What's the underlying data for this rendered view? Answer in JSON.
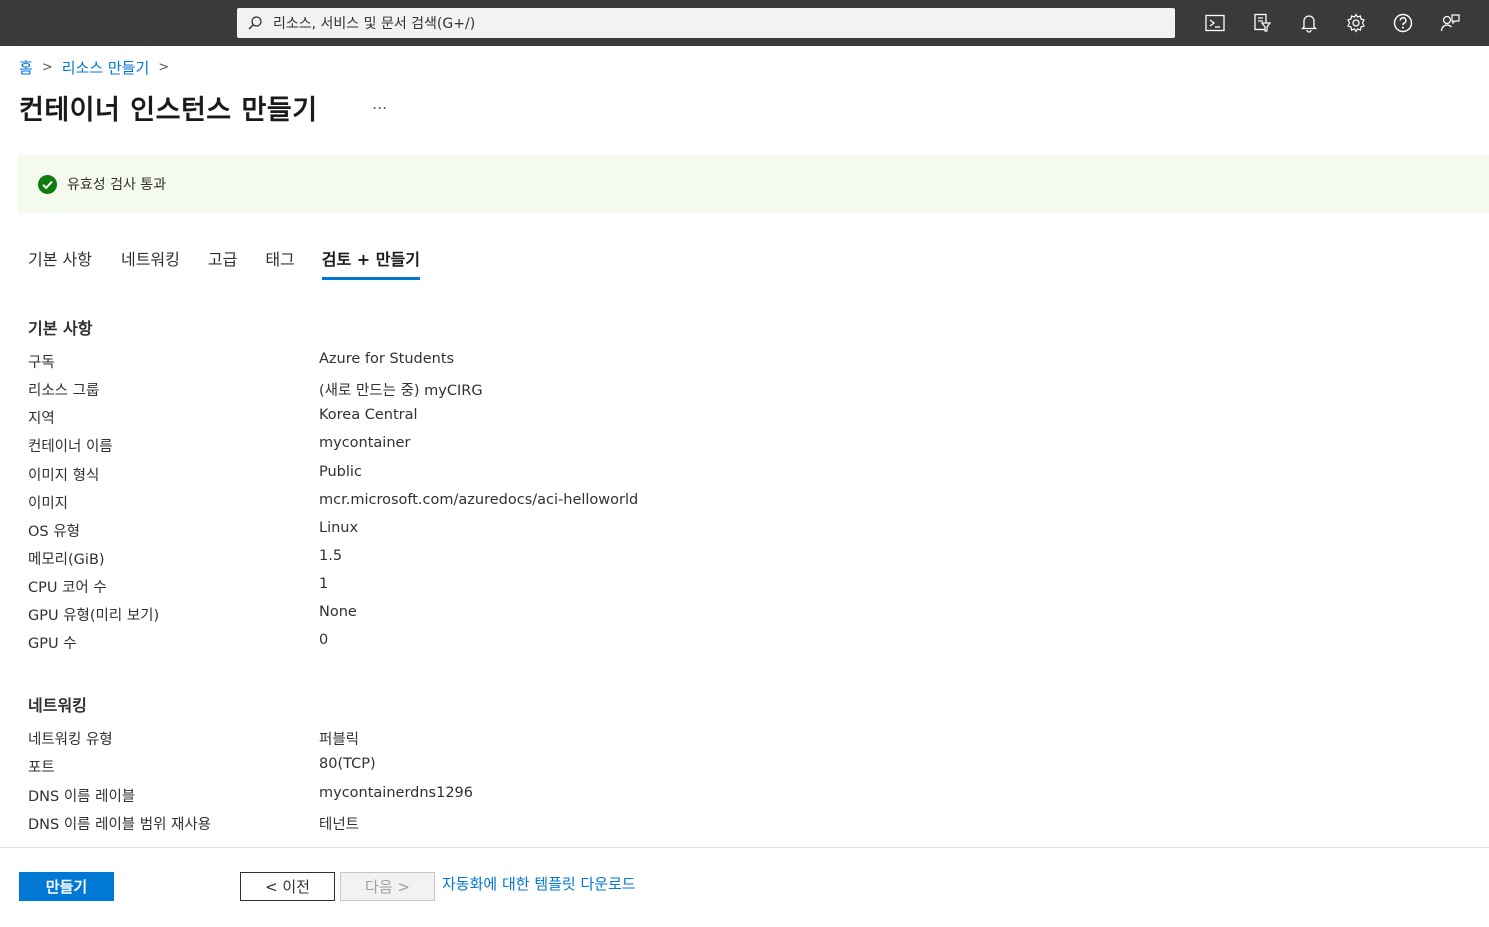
{
  "topbar": {
    "search_placeholder": "리소스, 서비스 및 문서 검색(G+/)",
    "icons": [
      "cloud-shell-icon",
      "directory-filter-icon",
      "notifications-bell-icon",
      "settings-gear-icon",
      "help-question-icon",
      "feedback-icon"
    ]
  },
  "breadcrumb": {
    "items": [
      "홈",
      "리소스 만들기"
    ]
  },
  "page": {
    "title": "컨테이너 인스턴스 만들기",
    "more": "..."
  },
  "banner": {
    "text": "유효성 검사 통과",
    "color": "#107c10"
  },
  "tabs": [
    {
      "label": "기본 사항"
    },
    {
      "label": "네트워킹"
    },
    {
      "label": "고급"
    },
    {
      "label": "태그"
    },
    {
      "label": "검토 + 만들기",
      "active": true
    }
  ],
  "basics": {
    "title": "기본 사항",
    "rows": [
      {
        "label": "구독",
        "value": "Azure for Students"
      },
      {
        "label": "리소스 그룹",
        "value": "(새로 만드는 중) myCIRG"
      },
      {
        "label": "지역",
        "value": "Korea Central"
      },
      {
        "label": "컨테이너 이름",
        "value": "mycontainer"
      },
      {
        "label": "이미지 형식",
        "value": "Public"
      },
      {
        "label": "이미지",
        "value": "mcr.microsoft.com/azuredocs/aci-helloworld"
      },
      {
        "label": "OS 유형",
        "value": "Linux"
      },
      {
        "label": "메모리(GiB)",
        "value": "1.5"
      },
      {
        "label": "CPU 코어 수",
        "value": "1"
      },
      {
        "label": "GPU 유형(미리 보기)",
        "value": "None"
      },
      {
        "label": "GPU 수",
        "value": "0"
      }
    ]
  },
  "networking": {
    "title": "네트워킹",
    "rows": [
      {
        "label": "네트워킹 유형",
        "value": "퍼블릭"
      },
      {
        "label": "포트",
        "value": "80(TCP)"
      },
      {
        "label": "DNS 이름 레이블",
        "value": "mycontainerdns1296"
      },
      {
        "label": "DNS 이름 레이블 범위 재사용",
        "value": "테넌트"
      }
    ]
  },
  "footer": {
    "create_label": "만들기",
    "prev_label": "< 이전",
    "next_label": "다음 >",
    "template_link": "자동화에 대한 템플릿 다운로드"
  },
  "colors": {
    "accent": "#0078d4",
    "topbar": "#3b3a39",
    "banner_bg": "#f4fbee"
  }
}
